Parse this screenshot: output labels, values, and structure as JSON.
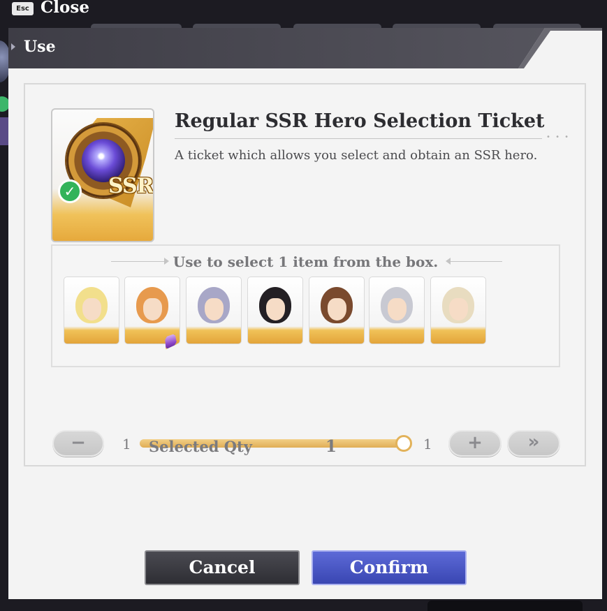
{
  "topbar": {
    "esc_key": "Esc",
    "close_label": "Close"
  },
  "dialog": {
    "title": "Use",
    "item": {
      "name": "Regular SSR Hero Selection Ticket",
      "description": "A ticket which allows you select and obtain an SSR hero.",
      "rarity_badge": "SSR",
      "checked": true
    },
    "selection": {
      "title": "Use to select 1 item from the box.",
      "heroes": [
        {
          "icon": "hero-blonde-long-hair-portrait",
          "hair": "#f2df8c"
        },
        {
          "icon": "hero-orange-hair-boy-portrait",
          "hair": "#e79a4e",
          "has_gem_badge": true
        },
        {
          "icon": "hero-silver-lavender-hair-portrait",
          "hair": "#a8a7c7"
        },
        {
          "icon": "hero-black-hair-woman-portrait",
          "hair": "#242024"
        },
        {
          "icon": "hero-brown-twin-tails-portrait",
          "hair": "#7a4a2e"
        },
        {
          "icon": "hero-white-hair-horned-portrait",
          "hair": "#c8c9d2"
        },
        {
          "icon": "hero-platinum-hair-horned-portrait",
          "hair": "#e8dcc0"
        }
      ]
    },
    "quantity": {
      "min_label": "1",
      "max_label": "1",
      "slider_fraction": 1.0,
      "minus_symbol": "−",
      "plus_symbol": "+",
      "max_symbol": "»",
      "selected_label": "Selected Qty",
      "selected_value": "1"
    },
    "buttons": {
      "cancel": "Cancel",
      "confirm": "Confirm"
    }
  },
  "colors": {
    "confirm_accent": "#4a56c6",
    "cancel_dark": "#38383e",
    "gold_accent": "#e2ab4f",
    "check_green": "#33b35a"
  }
}
